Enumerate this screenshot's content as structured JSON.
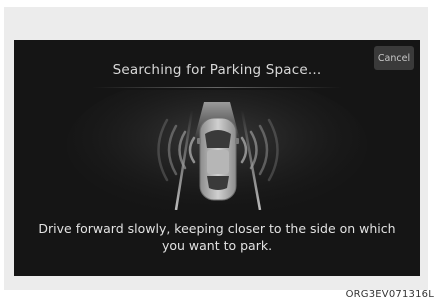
{
  "screen": {
    "title": "Searching for Parking Space...",
    "cancel_label": "Cancel",
    "instruction": "Drive forward slowly, keeping closer to the side on which you want to park."
  },
  "caption": "ORG3EV071316L",
  "icons": {
    "car": "car-top-view-icon",
    "sensor_waves_left": "sensor-waves-left-icon",
    "sensor_waves_right": "sensor-waves-right-icon"
  },
  "colors": {
    "screen_background": "#151515",
    "frame_background": "#ececec",
    "text": "#d8d8d8"
  }
}
